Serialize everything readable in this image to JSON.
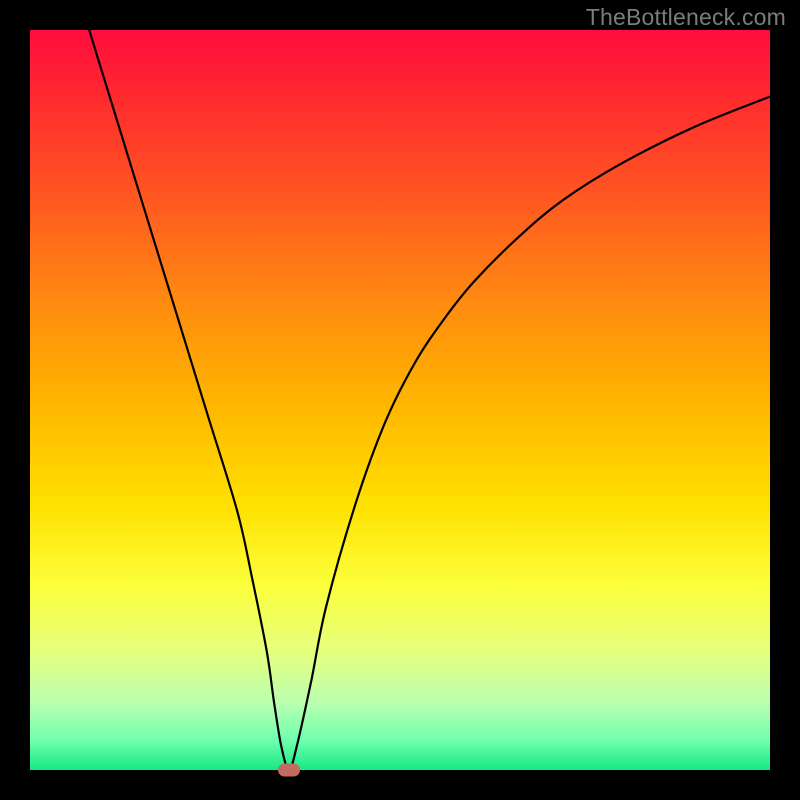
{
  "watermark": "TheBottleneck.com",
  "chart_data": {
    "type": "line",
    "title": "",
    "xlabel": "",
    "ylabel": "",
    "xlim": [
      0,
      100
    ],
    "ylim": [
      0,
      100
    ],
    "grid": false,
    "series": [
      {
        "name": "curve",
        "x": [
          8,
          12,
          16,
          20,
          24,
          28,
          30,
          32,
          33,
          34,
          35,
          36,
          38,
          40,
          44,
          48,
          52,
          56,
          60,
          66,
          72,
          80,
          90,
          100
        ],
        "y": [
          100,
          87,
          74,
          61,
          48,
          35,
          26,
          16,
          9,
          3,
          0,
          3,
          12,
          22,
          36,
          47,
          55,
          61,
          66,
          72,
          77,
          82,
          87,
          91
        ]
      }
    ],
    "annotations": [
      {
        "name": "min-marker",
        "x": 35,
        "y": 0
      }
    ],
    "colors": {
      "curve": "#000000",
      "marker": "#c36a61",
      "gradient_top": "#ff0c3e",
      "gradient_bottom": "#17e884"
    }
  }
}
